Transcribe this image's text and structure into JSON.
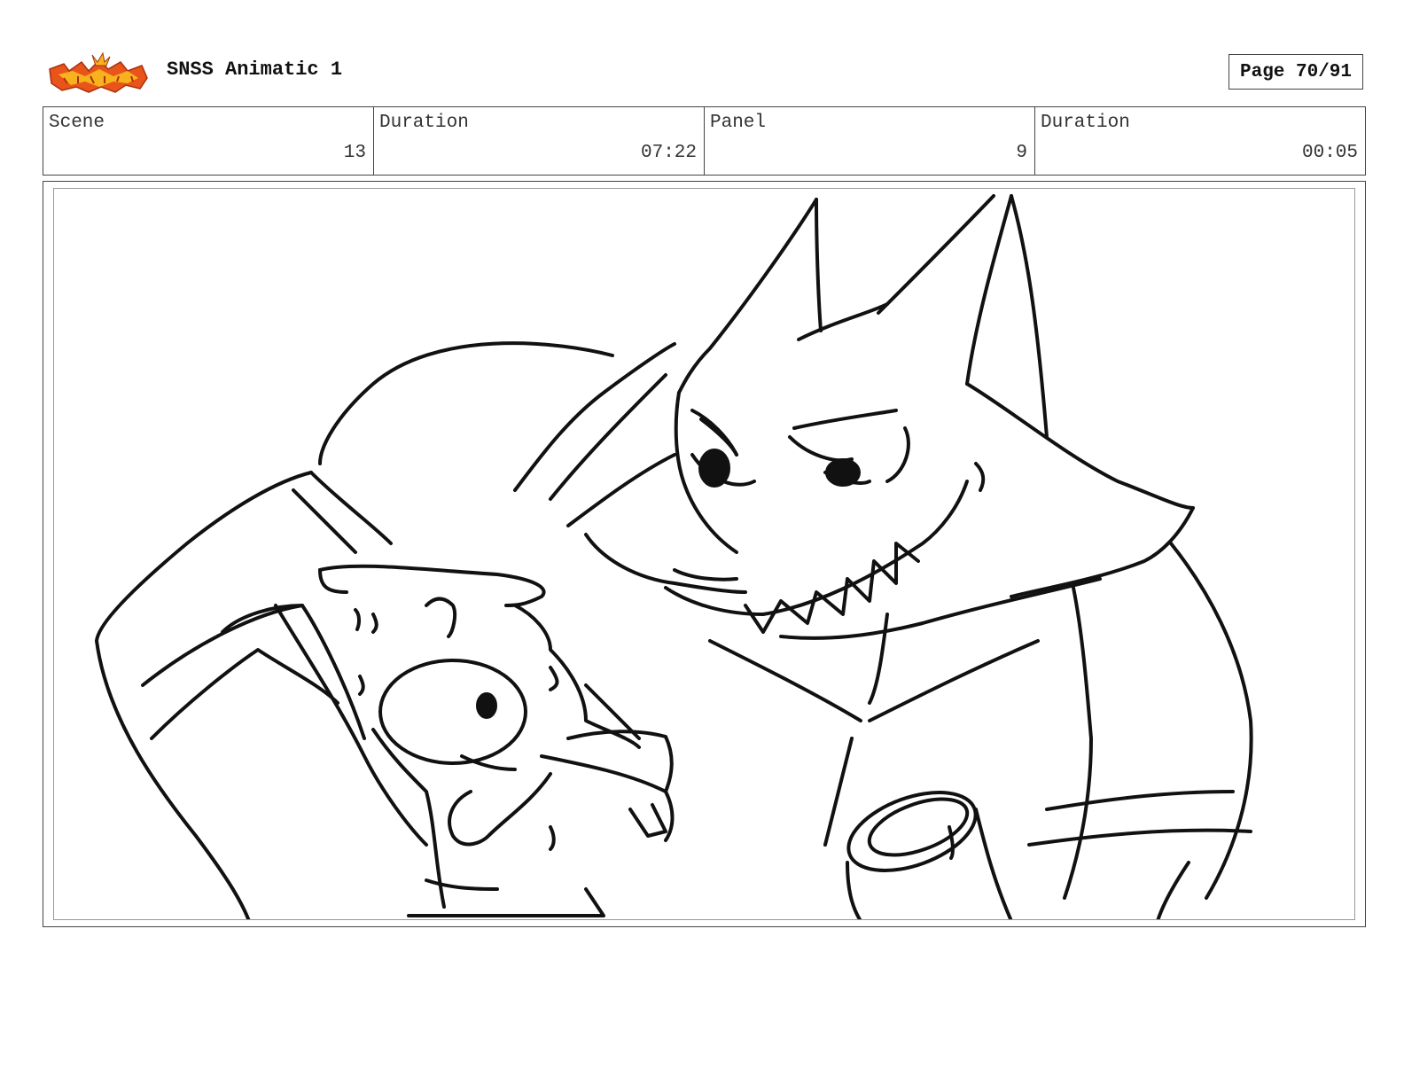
{
  "header": {
    "logo_icon": "show-logo-icon",
    "title": "SNSS Animatic 1",
    "page": "Page 70/91"
  },
  "info": {
    "scene": {
      "label": "Scene",
      "value": "13"
    },
    "scene_duration": {
      "label": "Duration",
      "value": "07:22"
    },
    "panel": {
      "label": "Panel",
      "value": "9"
    },
    "panel_duration": {
      "label": "Duration",
      "value": "00:05"
    }
  },
  "panel_image": {
    "icon": "storyboard-sketch-icon"
  },
  "colors": {
    "logo_primary": "#e8541a",
    "logo_secondary": "#f7b21d",
    "ink": "#111111"
  }
}
